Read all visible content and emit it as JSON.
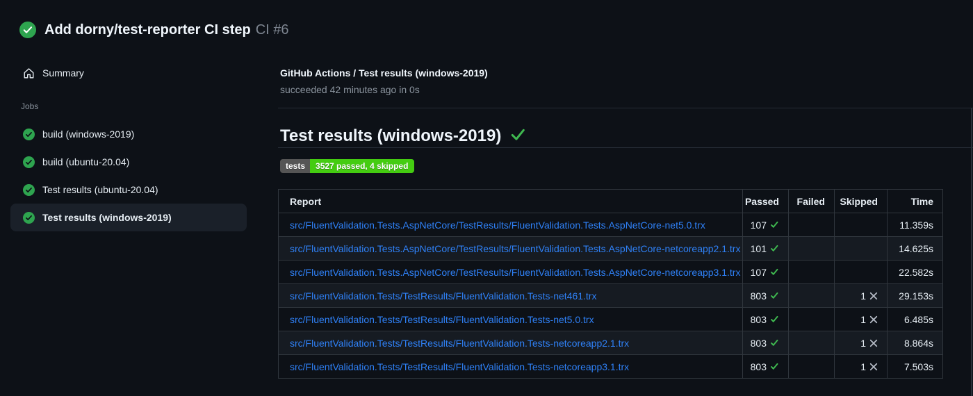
{
  "header": {
    "title": "Add dorny/test-reporter CI step",
    "run_number": "CI #6"
  },
  "sidebar": {
    "summary_label": "Summary",
    "jobs_label": "Jobs",
    "jobs": [
      {
        "label": "build (windows-2019)"
      },
      {
        "label": "build (ubuntu-20.04)"
      },
      {
        "label": "Test results (ubuntu-20.04)"
      },
      {
        "label": "Test results (windows-2019)"
      }
    ],
    "selected_job": "Test results (windows-2019)"
  },
  "main": {
    "run_title": "GitHub Actions / Test results (windows-2019)",
    "run_status": "succeeded 42 minutes ago in 0s",
    "section_heading": "Test results (windows-2019)",
    "badge": {
      "label": "tests",
      "value": "3527 passed, 4 skipped",
      "label_bg": "#555555",
      "value_bg": "#44cc11"
    }
  },
  "table": {
    "columns": [
      "Report",
      "Passed",
      "Failed",
      "Skipped",
      "Time"
    ],
    "rows": [
      {
        "report": "src/FluentValidation.Tests.AspNetCore/TestResults/FluentValidation.Tests.AspNetCore-net5.0.trx",
        "passed": "107",
        "failed": "",
        "skipped": "",
        "time": "11.359s"
      },
      {
        "report": "src/FluentValidation.Tests.AspNetCore/TestResults/FluentValidation.Tests.AspNetCore-netcoreapp2.1.trx",
        "passed": "101",
        "failed": "",
        "skipped": "",
        "time": "14.625s"
      },
      {
        "report": "src/FluentValidation.Tests.AspNetCore/TestResults/FluentValidation.Tests.AspNetCore-netcoreapp3.1.trx",
        "passed": "107",
        "failed": "",
        "skipped": "",
        "time": "22.582s"
      },
      {
        "report": "src/FluentValidation.Tests/TestResults/FluentValidation.Tests-net461.trx",
        "passed": "803",
        "failed": "",
        "skipped": "1",
        "time": "29.153s"
      },
      {
        "report": "src/FluentValidation.Tests/TestResults/FluentValidation.Tests-net5.0.trx",
        "passed": "803",
        "failed": "",
        "skipped": "1",
        "time": "6.485s"
      },
      {
        "report": "src/FluentValidation.Tests/TestResults/FluentValidation.Tests-netcoreapp2.1.trx",
        "passed": "803",
        "failed": "",
        "skipped": "1",
        "time": "8.864s"
      },
      {
        "report": "src/FluentValidation.Tests/TestResults/FluentValidation.Tests-netcoreapp3.1.trx",
        "passed": "803",
        "failed": "",
        "skipped": "1",
        "time": "7.503s"
      }
    ]
  },
  "colors": {
    "success_green": "#2ea44f",
    "check_green": "#3fb950",
    "link_blue": "#2f81f7",
    "skipped_gray": "#b7bdc8"
  }
}
